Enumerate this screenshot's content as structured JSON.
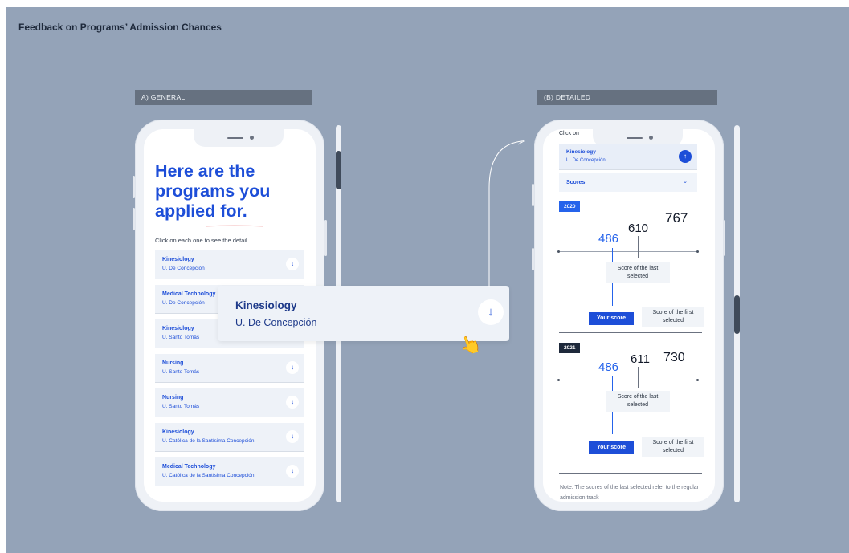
{
  "page_title": "Feedback on Programs’ Admission Chances",
  "sections": {
    "general_label": "A) GENERAL",
    "detailed_label": "(B) DETAILED"
  },
  "general": {
    "hero": "Here are the programs you applied for.",
    "hint": "Click on each one to see the detail",
    "programs": [
      {
        "name": "Kinesiology",
        "university": "U. De Concepción"
      },
      {
        "name": "Medical Technology",
        "university": "U. De Concepción"
      },
      {
        "name": "Kinesiology",
        "university": "U. Santo Tomás"
      },
      {
        "name": "Nursing",
        "university": "U. Santo Tomás"
      },
      {
        "name": "Nursing",
        "university": "U. Santo Tomás"
      },
      {
        "name": "Kinesiology",
        "university": "U. Católica de la Santísima Concepción"
      },
      {
        "name": "Medical Technology",
        "university": "U. Católica de la Santísima Concepción"
      }
    ],
    "expanded_card": {
      "name": "Kinesiology",
      "university": "U. De Concepción"
    }
  },
  "detailed": {
    "click_on": "Click on",
    "program": {
      "name": "Kinesiology",
      "university": "U. De Concepción"
    },
    "scores_label": "Scores",
    "years": [
      {
        "year": "2020",
        "your_score": "486",
        "last_selected": "610",
        "first_selected": "767",
        "last_selected_label": "Score of the last selected",
        "first_selected_label": "Score of the first selected",
        "your_score_label": "Your score"
      },
      {
        "year": "2021",
        "your_score": "486",
        "last_selected": "611",
        "first_selected": "730",
        "last_selected_label": "Score of the last selected",
        "first_selected_label": "Score of the first selected",
        "your_score_label": "Your score"
      }
    ],
    "note": "Note: The scores of the last selected refer to the regular admission track"
  },
  "icons": {
    "expand": "↓",
    "collapse": "↑",
    "dropdown": "⌄"
  },
  "colors": {
    "background": "#94a3b8",
    "accent": "#1d4ed8",
    "year_2020": "#2563eb",
    "year_2021": "#1e293b"
  }
}
